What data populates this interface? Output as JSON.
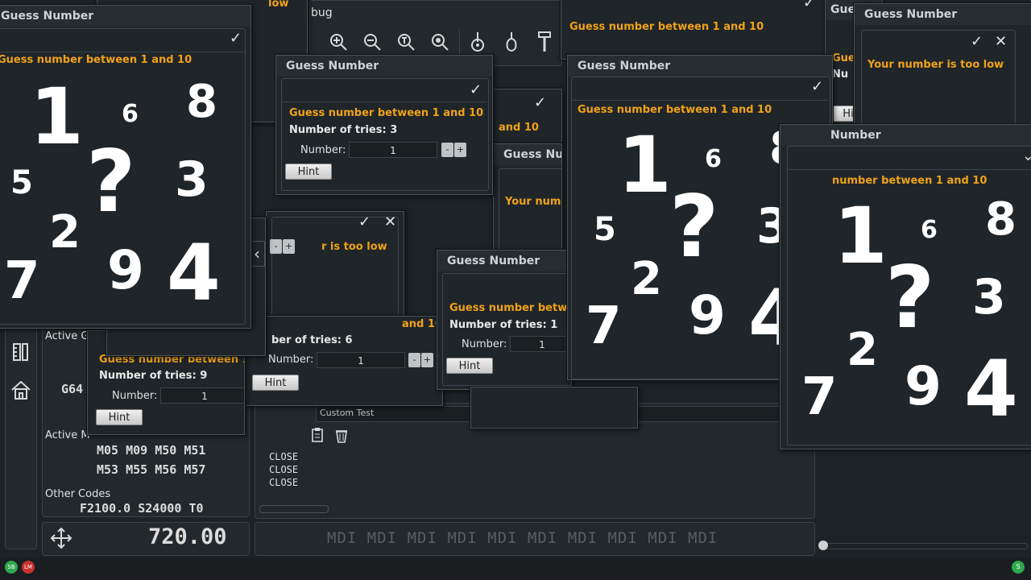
{
  "window_title": "Guess Number",
  "dialogs": {
    "guess_prompt": "Guess number between 1 and 10",
    "guess_prompt_cut1": "Guess number betwe",
    "guess_prompt_cut2": "number between 1 and 10",
    "guess_prompt_cut3": "Guess number between 1",
    "guess_prompt_cut4": "and 10",
    "too_low": "Your number is too low",
    "too_low_cut": "r is too low",
    "your_num_cut": "Your num",
    "tries_3": "Number of tries: 3",
    "tries_1": "Number of tries: 1",
    "tries_9": "Number of tries: 9",
    "tries_6_cut": "ber of tries: 6",
    "number_label": "Number:",
    "number_value": "1",
    "hint_label": "Hint",
    "title_cut": "Gue",
    "title_cut2": "Number",
    "title_cut3": "Guess Nu",
    "title_cut4": "Gue",
    "title_cut5": "Nu",
    "title_cut6": "Hi"
  },
  "digits": {
    "one": "1",
    "two": "2",
    "three": "3",
    "four": "4",
    "five": "5",
    "six": "6",
    "seven": "7",
    "eight": "8",
    "nine": "9",
    "question": "?"
  },
  "background": {
    "debug_tab": "bug",
    "active_g": "Active G",
    "g64": "G64",
    "active_m": "Active M",
    "m_row1": "M05  M09  M50  M51",
    "m_row2": "M53  M55  M56  M57",
    "other_codes": "Other Codes",
    "other_values": "F2100.0  S24000  T0",
    "position_value": "720.00",
    "mdi_word": "MDI",
    "custom_test": "Custom Test",
    "close_lines": [
      "CLOSE",
      "CLOSE",
      "CLOSE"
    ],
    "status_left_a": "SB",
    "status_left_b": "LM",
    "status_right": "S",
    "top_cut_text": "low"
  },
  "icons": {
    "check": "✓",
    "close": "✕",
    "zoom_in": "zoom-in-icon",
    "zoom_out": "zoom-out-icon",
    "zoom_fit": "zoom-fit-icon",
    "zoom_extent": "zoom-extent-icon",
    "tool": "tool-icon",
    "drop": "drop-icon",
    "endmill": "endmill-icon",
    "move": "move-icon",
    "home": "home-icon",
    "ruler": "ruler-icon",
    "clipboard": "clipboard-icon",
    "trash": "trash-icon",
    "arrow_left": "‹",
    "chevron_down": "⌄"
  },
  "colors": {
    "accent": "#f0a218",
    "background": "#1d2226",
    "status_green": "#2fa84f",
    "status_red": "#c8322e"
  }
}
